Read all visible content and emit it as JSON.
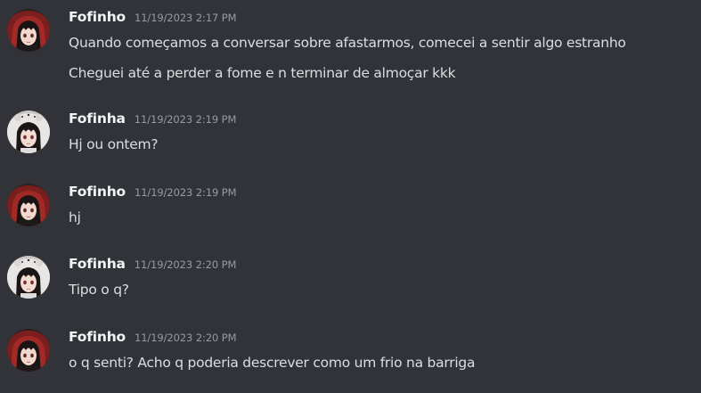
{
  "messages": [
    {
      "author": "Fofinho",
      "avatar": "red-hooded-girl-avatar",
      "timestamp": "11/19/2023 2:17 PM",
      "lines": [
        "Quando começamos a conversar sobre afastarmos, comecei a sentir algo estranho",
        "Cheguei até a perder a fome e n terminar de almoçar kkk"
      ]
    },
    {
      "author": "Fofinha",
      "avatar": "white-hooded-girl-avatar",
      "timestamp": "11/19/2023 2:19 PM",
      "lines": [
        "Hj ou ontem?"
      ]
    },
    {
      "author": "Fofinho",
      "avatar": "red-hooded-girl-avatar",
      "timestamp": "11/19/2023 2:19 PM",
      "lines": [
        "hj"
      ]
    },
    {
      "author": "Fofinha",
      "avatar": "white-hooded-girl-avatar",
      "timestamp": "11/19/2023 2:20 PM",
      "lines": [
        "Tipo o q?"
      ]
    },
    {
      "author": "Fofinho",
      "avatar": "red-hooded-girl-avatar",
      "timestamp": "11/19/2023 2:20 PM",
      "lines": [
        "o q senti? Acho q poderia descrever como um frio na barriga"
      ]
    }
  ],
  "colors": {
    "background": "#313338",
    "username": "#f2f3f5",
    "timestamp": "#949ba4",
    "text": "#dbdee1"
  }
}
